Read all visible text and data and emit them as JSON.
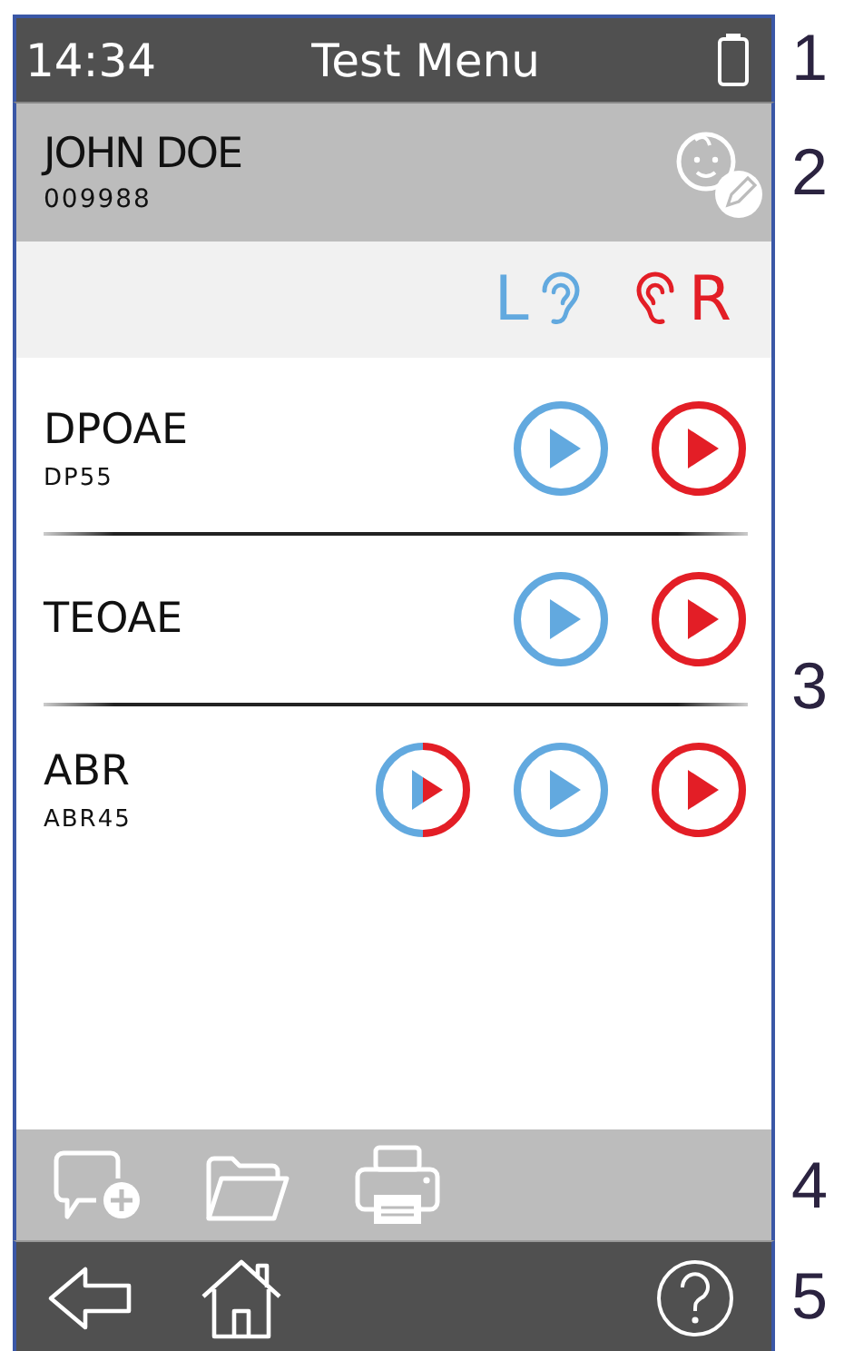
{
  "status_bar": {
    "time": "14:34",
    "title": "Test Menu"
  },
  "patient": {
    "name": "JOHN DOE",
    "id": "009988"
  },
  "ear_header": {
    "left": "L",
    "right": "R"
  },
  "tests": [
    {
      "name": "DPOAE",
      "code": "DP55",
      "buttons": [
        {
          "kind": "left"
        },
        {
          "kind": "right"
        }
      ]
    },
    {
      "name": "TEOAE",
      "buttons": [
        {
          "kind": "left"
        },
        {
          "kind": "right"
        }
      ]
    },
    {
      "name": "ABR",
      "code": "ABR45",
      "buttons": [
        {
          "kind": "both"
        },
        {
          "kind": "left"
        },
        {
          "kind": "right"
        }
      ]
    }
  ],
  "callouts": [
    "1",
    "2",
    "3",
    "4",
    "5"
  ]
}
